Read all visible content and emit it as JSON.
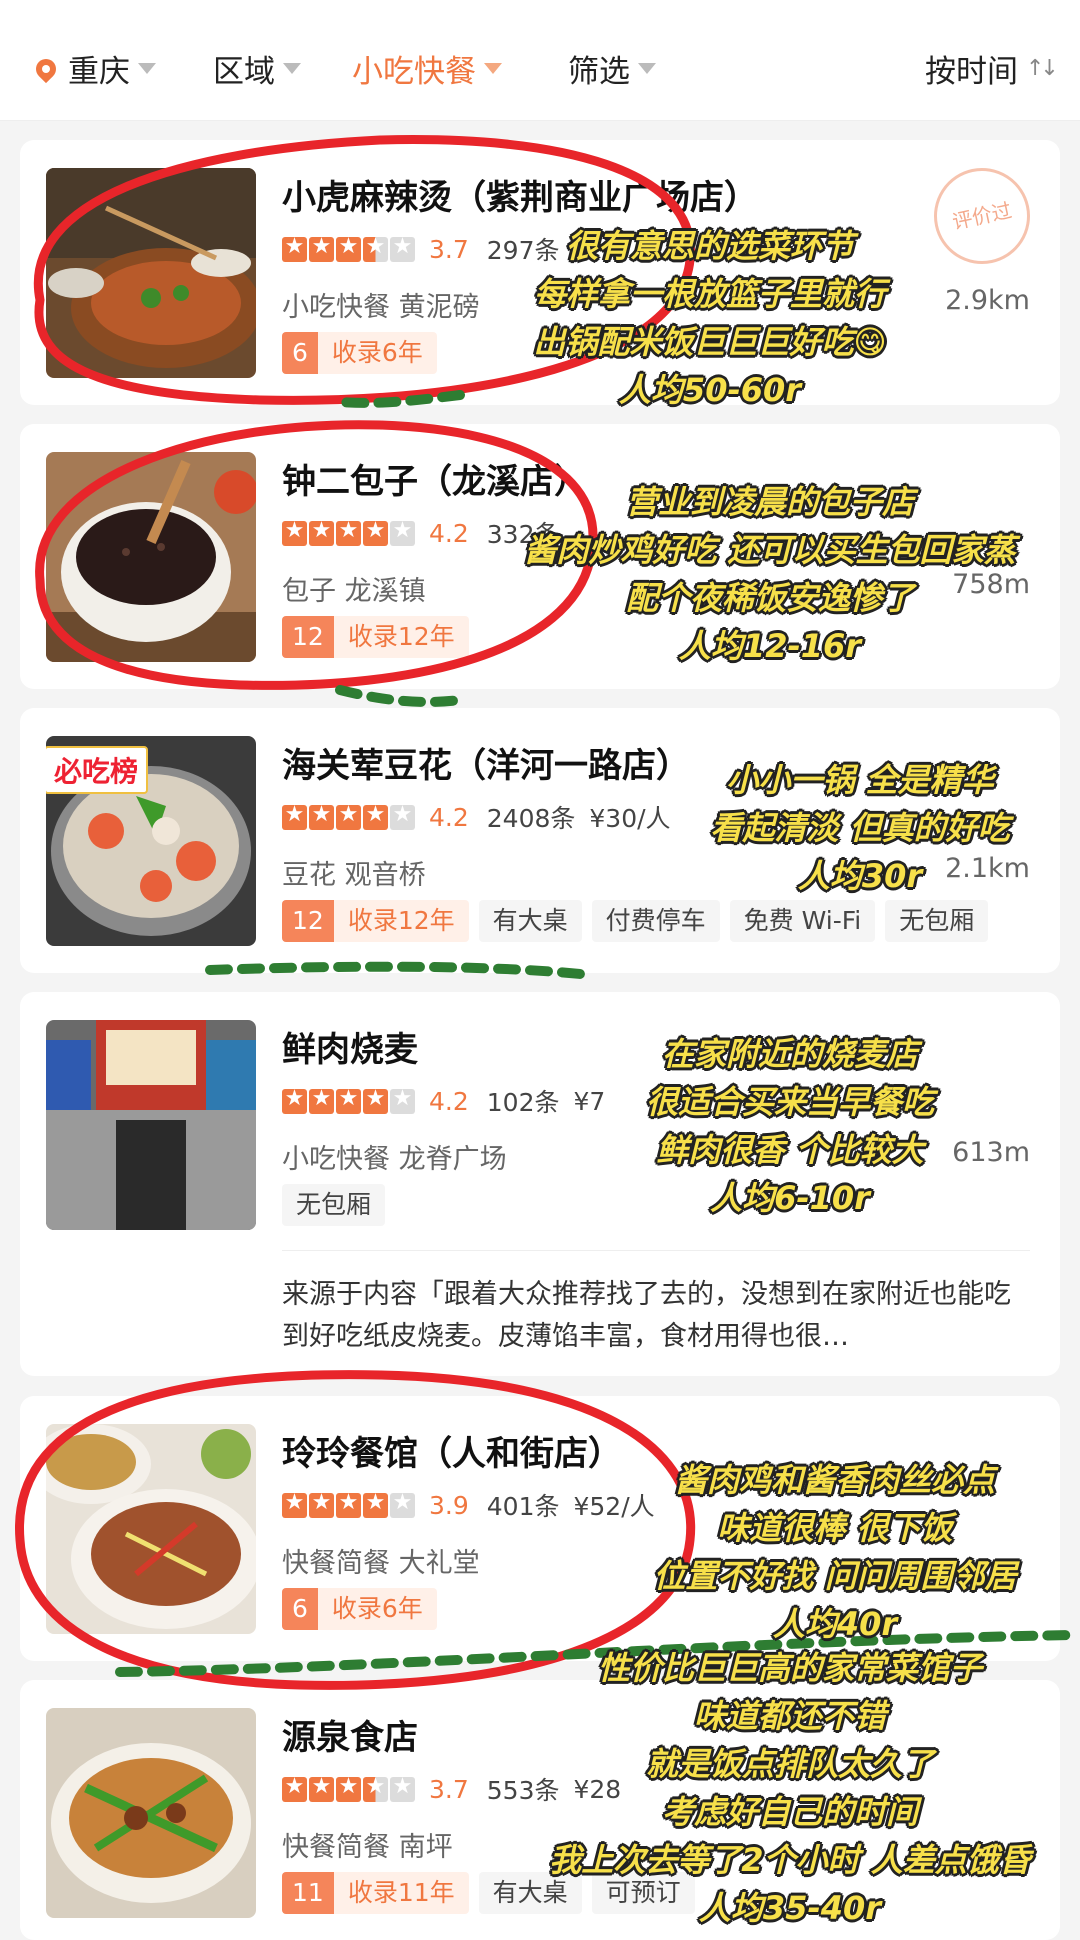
{
  "filters": {
    "city": "重庆",
    "area": "区域",
    "category": "小吃快餐",
    "screen": "筛选",
    "sort": "按时间"
  },
  "restaurants": [
    {
      "name": "小虎麻辣烫（紫荆商业广场店）",
      "rating": 3.7,
      "rating_text": "3.7",
      "reviews": "297条",
      "price": "",
      "category": "小吃快餐 黄泥磅",
      "distance": "2.9km",
      "years_num": "6",
      "years_label": "收录6年",
      "tags": [],
      "stamp": "评价过"
    },
    {
      "name": "钟二包子（龙溪店）",
      "rating": 4.2,
      "rating_text": "4.2",
      "reviews": "332条",
      "price": "",
      "category": "包子 龙溪镇",
      "distance": "758m",
      "years_num": "12",
      "years_label": "收录12年",
      "tags": []
    },
    {
      "name": "海关荤豆花（洋河一路店）",
      "rating": 4.2,
      "rating_text": "4.2",
      "reviews": "2408条",
      "price": "¥30/人",
      "category": "豆花 观音桥",
      "distance": "2.1km",
      "years_num": "12",
      "years_label": "收录12年",
      "tags": [
        "有大桌",
        "付费停车",
        "免费 Wi-Fi",
        "无包厢"
      ],
      "badge": "必吃榜"
    },
    {
      "name": "鲜肉烧麦",
      "rating": 4.2,
      "rating_text": "4.2",
      "reviews": "102条",
      "price": "¥7",
      "category": "小吃快餐 龙脊广场",
      "distance": "613m",
      "tags": [
        "无包厢"
      ],
      "source": "来源于内容「跟着大众推荐找了去的，没想到在家附近也能吃到好吃纸皮烧麦。皮薄馅丰富，食材用得也很…"
    },
    {
      "name": "玲玲餐馆（人和街店）",
      "rating": 3.9,
      "rating_text": "3.9",
      "reviews": "401条",
      "price": "¥52/人",
      "category": "快餐简餐 大礼堂",
      "distance": "",
      "years_num": "6",
      "years_label": "收录6年",
      "tags": []
    },
    {
      "name": "源泉食店",
      "rating": 3.7,
      "rating_text": "3.7",
      "reviews": "553条",
      "price": "¥28",
      "category": "快餐简餐 南坪",
      "distance": "",
      "years_num": "11",
      "years_label": "收录11年",
      "tags": [
        "有大桌",
        "可预订"
      ]
    }
  ],
  "annotations": [
    {
      "lines": [
        "很有意思的选菜环节",
        "每样拿一根放篮子里就行",
        "出锅配米饭巨巨巨好吃😋",
        "人均50-60r"
      ]
    },
    {
      "lines": [
        "营业到凌晨的包子店",
        "酱肉炒鸡好吃 还可以买生包回家蒸",
        "配个夜稀饭安逸惨了",
        "人均12-16r"
      ]
    },
    {
      "lines": [
        "小小一锅 全是精华",
        "看起清淡 但真的好吃",
        "人均30r"
      ]
    },
    {
      "lines": [
        "在家附近的烧麦店",
        "很适合买来当早餐吃",
        "鲜肉很香 个比较大",
        "人均6-10r"
      ]
    },
    {
      "lines": [
        "酱肉鸡和酱香肉丝必点",
        "味道很棒 很下饭",
        "位置不好找 问问周围邻居",
        "人均40r"
      ]
    },
    {
      "lines": [
        "性价比巨巨高的家常菜馆子",
        "味道都还不错",
        "就是饭点排队太久了",
        "考虑好自己的时间",
        "我上次去等了2个小时 人差点饿昏",
        "人均35-40r"
      ]
    }
  ],
  "colors": {
    "accent": "#f07740",
    "annotation_text": "#f7e04a",
    "circle": "#e8252a",
    "dash": "#2e7d32"
  }
}
